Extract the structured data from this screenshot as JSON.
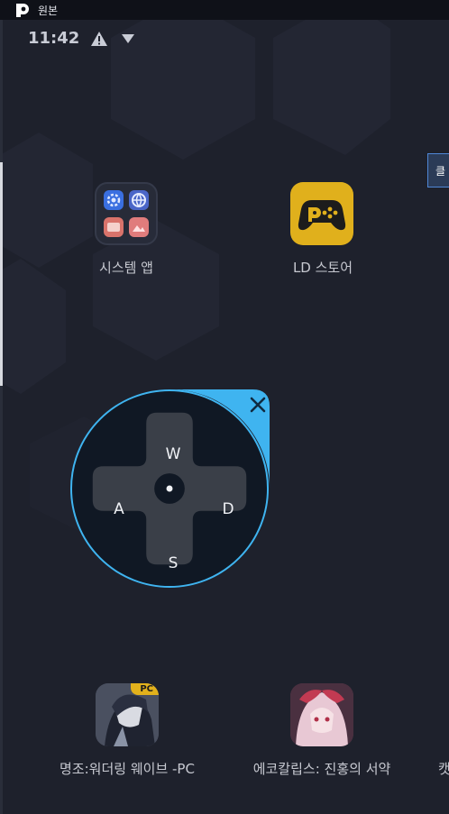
{
  "window": {
    "title": "원본"
  },
  "status_bar": {
    "time": "11:42",
    "icons": [
      "warning-icon",
      "signal-triangle-icon"
    ]
  },
  "edge_tooltip": {
    "text": "클"
  },
  "apps": [
    {
      "label": "시스템 앱",
      "icon": "system-apps-folder-icon"
    },
    {
      "label": "LD 스토어",
      "icon": "gamepad-icon"
    },
    {
      "label": "명조:워더링 웨이브 -PC",
      "icon": "wuthering-waves-thumbnail",
      "badge": "PC"
    },
    {
      "label": "에코칼립스: 진홍의 서약",
      "icon": "echocalypse-thumbnail"
    },
    {
      "label": "캣",
      "icon": "partial-app"
    }
  ],
  "dpad": {
    "up": "W",
    "left": "A",
    "right": "D",
    "down": "S",
    "accent_color": "#3fb4f0",
    "close_icon": "close-icon"
  }
}
